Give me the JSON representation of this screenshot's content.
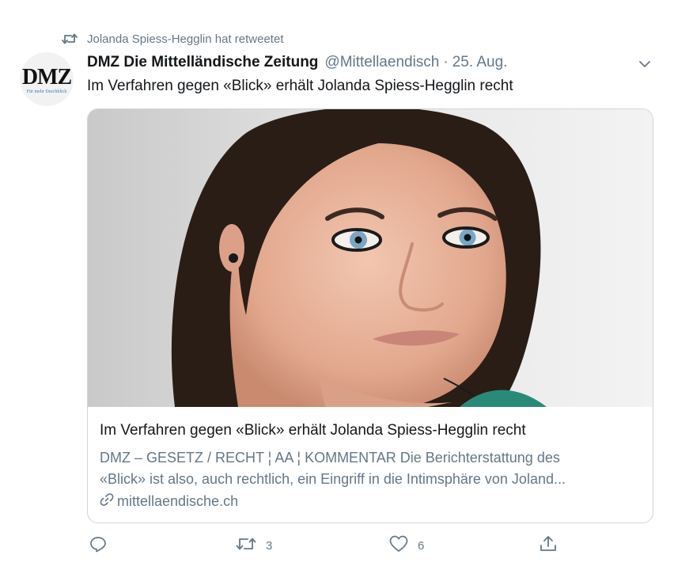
{
  "retweet": {
    "icon": "retweet-icon",
    "text": "Jolanda Spiess-Hegglin hat retweetet"
  },
  "author": {
    "avatar_text": "DMZ",
    "avatar_subtext": "Für mehr Durchblick",
    "name": "DMZ Die Mittelländische Zeitung",
    "handle": "@Mittellaendisch",
    "separator": "·",
    "date": "25. Aug."
  },
  "tweet": {
    "text": "Im Verfahren gegen «Blick» erhält Jolanda Spiess-Hegglin recht"
  },
  "card": {
    "title": "Im Verfahren gegen «Blick» erhält Jolanda Spiess-Hegglin recht",
    "description_line1": "DMZ – GESETZ / RECHT ¦ AA ¦ KOMMENTAR Die Berichterstattung des",
    "description_line2": "«Blick» ist also, auch rechtlich, ein Eingriff in die Intimsphäre von Joland...",
    "domain": "mittellaendische.ch"
  },
  "actions": {
    "reply_count": "",
    "retweet_count": "3",
    "like_count": "6",
    "share_count": ""
  },
  "colors": {
    "text_primary": "#14171a",
    "text_secondary": "#657786",
    "border": "#ccd6dd"
  }
}
